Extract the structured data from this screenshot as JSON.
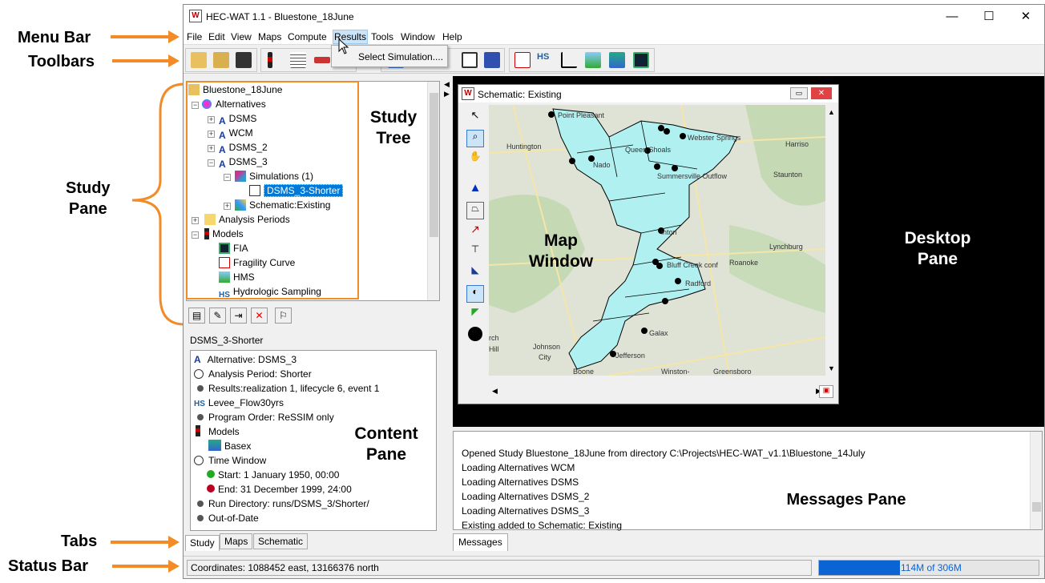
{
  "window": {
    "title": "HEC-WAT 1.1 - Bluestone_18June",
    "minimize": "—",
    "maximize": "☐",
    "close": "✕"
  },
  "menu": [
    "File",
    "Edit",
    "View",
    "Maps",
    "Compute",
    "Results",
    "Tools",
    "Window",
    "Help"
  ],
  "results_menu": {
    "item": "Select Simulation...."
  },
  "annotations": {
    "menu_bar": "Menu Bar",
    "toolbars": "Toolbars",
    "study_pane": "Study\nPane",
    "study_tree": "Study\nTree",
    "map_window": "Map\nWindow",
    "desktop_pane": "Desktop\nPane",
    "content_pane": "Content\nPane",
    "messages_pane": "Messages Pane",
    "tabs": "Tabs",
    "status_bar": "Status Bar"
  },
  "tree": {
    "root": "Bluestone_18June",
    "alternatives": "Alternatives",
    "alts": [
      "DSMS",
      "WCM",
      "DSMS_2",
      "DSMS_3"
    ],
    "simulations": "Simulations (1)",
    "selected_sim": "DSMS_3-Shorter",
    "schematic": "Schematic:Existing",
    "analysis_periods": "Analysis Periods",
    "models": "Models",
    "model_items": [
      "FIA",
      "Fragility Curve",
      "HMS",
      "Hydrologic Sampling"
    ]
  },
  "content": {
    "title": "DSMS_3-Shorter",
    "alternative": "Alternative: DSMS_3",
    "analysis_period": "Analysis Period: Shorter",
    "results": "Results:realization 1, lifecycle 6, event 1",
    "levee": "Levee_Flow30yrs",
    "program_order": "Program Order: ReSSIM only",
    "models": "Models",
    "basex": "Basex",
    "time_window": "Time Window",
    "start": "Start: 1 January 1950, 00:00",
    "end": "End: 31 December 1999, 24:00",
    "run_dir": "Run Directory: runs/DSMS_3/Shorter/",
    "out_of_date": "Out-of-Date"
  },
  "tabs": [
    "Study",
    "Maps",
    "Schematic"
  ],
  "map": {
    "title": "Schematic: Existing",
    "places": [
      "Point Pleasant",
      "Huntington",
      "Queen Shoals",
      "Webster Springs",
      "Harriso",
      "Nado",
      "Summersville Outflow",
      "Staunton",
      "Lynchburg",
      "inton",
      "Roanoke",
      "Bluff Creek conf",
      "Radford",
      "Galax",
      "Johnson",
      "City",
      "rch",
      "Hill",
      "Jefferson",
      "Winston-",
      "Greensboro",
      "Boone"
    ]
  },
  "messages": {
    "lines": [
      "Opened Study Bluestone_18June from directory C:\\Projects\\HEC-WAT_v1.1\\Bluestone_14July",
      "Loading Alternatives WCM",
      "Loading Alternatives DSMS",
      "Loading Alternatives DSMS_2",
      "Loading Alternatives DSMS_3",
      "Existing added to Schematic: Existing"
    ],
    "tab": "Messages"
  },
  "status": {
    "coords": "Coordinates: 1088452 east, 13166376 north",
    "memory": "114M of 306M",
    "memory_used_fraction": 0.37
  },
  "colors": {
    "accent": "#f28c28",
    "selection": "#0078d7",
    "watershed": "#b0f0f0"
  }
}
